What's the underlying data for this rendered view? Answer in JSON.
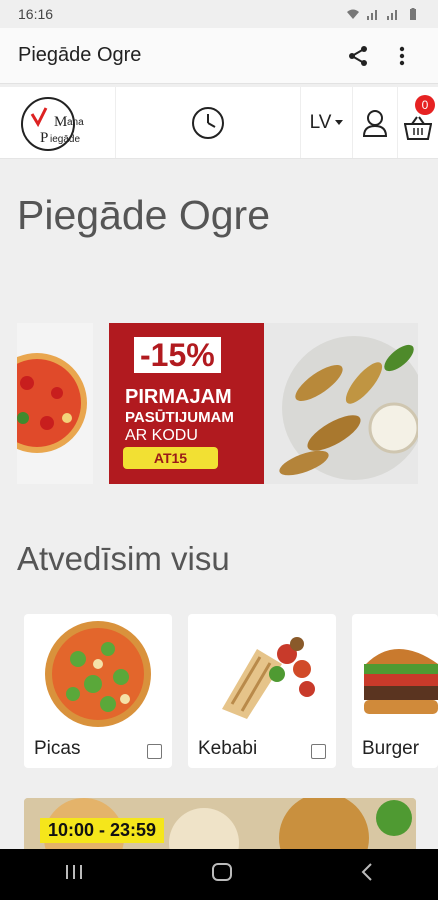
{
  "statusbar": {
    "time": "16:16"
  },
  "appbar": {
    "title": "Piegāde Ogre"
  },
  "header": {
    "language": "LV",
    "cart_count": "0"
  },
  "logo": {
    "text_top": "Mana",
    "text_bottom": "Piegāde"
  },
  "page": {
    "heading": "Piegāde Ogre"
  },
  "promo": {
    "discount": "-15%",
    "line1": "PIRMAJAM",
    "line2": "PASŪTIJUMAM",
    "line3": "AR KODU",
    "code": "AT15"
  },
  "categories": {
    "heading": "Atvedīsim visu",
    "items": [
      {
        "label": "Picas"
      },
      {
        "label": "Kebabi"
      },
      {
        "label": "Burger"
      }
    ]
  },
  "restaurant": {
    "hours": "10:00 - 23:59"
  },
  "colors": {
    "accent_red": "#b11a1f",
    "badge_red": "#e62222",
    "highlight_yellow": "#f5e61b"
  }
}
